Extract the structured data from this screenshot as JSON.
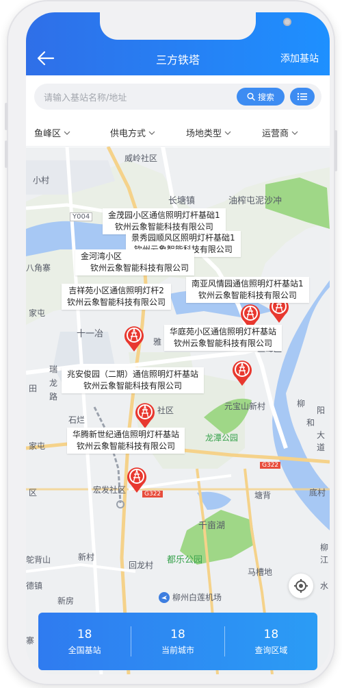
{
  "header": {
    "title": "三方铁塔",
    "add_button": "添加基站"
  },
  "search": {
    "placeholder": "请输入基站名称/地址",
    "button": "搜索"
  },
  "filters": [
    "鱼峰区",
    "供电方式",
    "场地类型",
    "运营商"
  ],
  "map": {
    "places": [
      "威岭社区",
      "小村",
      "长塘镇",
      "油榨屯泥沙冲",
      "Y004",
      "八角寨",
      "家屯",
      "十一冶",
      "雅",
      "瑞",
      "龙",
      "路",
      "田",
      "石烂",
      "社区",
      "元宝山新村",
      "柳",
      "阳",
      "和",
      "大",
      "道",
      "家屯",
      "龙潭公园",
      "G322",
      "宏发社区",
      "G322",
      "塘背",
      "底村",
      "千亩湖",
      "区",
      "新村",
      "都乐公园",
      "柳",
      "江",
      "马槽地",
      "鸵背山",
      "回龙村",
      "德镇",
      "新房",
      "柳州白莲机场",
      "寨",
      "鱼峰区",
      "水"
    ],
    "stations": [
      {
        "name": "金茂园小区通信照明灯杆基础1",
        "company": "钦州云象智能科技有限公司"
      },
      {
        "name": "景秀园顺风区照明灯杆基础1",
        "company": "钦州云象智能科技有限公司"
      },
      {
        "name": "金河湾小区",
        "company": "钦州云象智能科技有限公司"
      },
      {
        "name": "南亚风情园通信照明灯杆基站1",
        "company": "钦州云象智能科技有限公司"
      },
      {
        "name": "吉祥苑小区通信照明灯杆2",
        "company": "钦州云象智能科技有限公司"
      },
      {
        "name": "华庭苑小区通信照明灯杆基站",
        "company": "钦州云象智能科技有限公司"
      },
      {
        "name": "兆安俊园（二期）通信照明灯杆基站",
        "company": "钦州云象智能科技有限公司"
      },
      {
        "name": "华腾新世纪通信照明灯杆基站",
        "company": "钦州云象智能科技有限公司"
      }
    ]
  },
  "stats": [
    {
      "value": "18",
      "label": "全国基站"
    },
    {
      "value": "18",
      "label": "当前城市"
    },
    {
      "value": "18",
      "label": "查询区域"
    }
  ],
  "colors": {
    "brand": "#2f7bf0",
    "pin": "#e8382f"
  }
}
